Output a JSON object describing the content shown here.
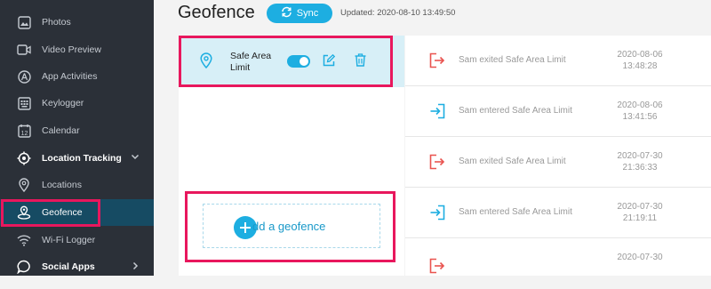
{
  "sidebar": {
    "items": [
      {
        "label": "Photos",
        "icon": "image-icon"
      },
      {
        "label": "Video Preview",
        "icon": "video-icon"
      },
      {
        "label": "App Activities",
        "icon": "app-store-icon"
      },
      {
        "label": "Keylogger",
        "icon": "keyboard-icon"
      },
      {
        "label": "Calendar",
        "icon": "calendar-icon"
      },
      {
        "label": "Location Tracking",
        "icon": "crosshair-icon"
      },
      {
        "label": "Locations",
        "icon": "map-pin-icon"
      },
      {
        "label": "Geofence",
        "icon": "geofence-icon"
      },
      {
        "label": "Wi-Fi Logger",
        "icon": "wifi-icon"
      },
      {
        "label": "Social Apps",
        "icon": "chat-bubble-icon"
      }
    ],
    "calendar_day": "12"
  },
  "header": {
    "title": "Geofence",
    "sync_label": "Sync",
    "updated": "Updated: 2020-08-10 13:49:50"
  },
  "geofences": [
    {
      "name": "Safe Area Limit",
      "enabled": true
    }
  ],
  "add_geofence_label": "dd a geofence",
  "events": [
    {
      "text": "Sam exited Safe Area Limit",
      "date": "2020-08-06",
      "time": "13:48:28",
      "type": "exit"
    },
    {
      "text": "Sam entered Safe Area Limit",
      "date": "2020-08-06",
      "time": "13:41:56",
      "type": "enter"
    },
    {
      "text": "Sam exited Safe Area Limit",
      "date": "2020-07-30",
      "time": "21:36:33",
      "type": "exit"
    },
    {
      "text": "Sam entered Safe Area Limit",
      "date": "2020-07-30",
      "time": "21:19:11",
      "type": "enter"
    },
    {
      "text": "",
      "date": "2020-07-30",
      "time": "",
      "type": "exit"
    }
  ],
  "colors": {
    "accent": "#1daee1",
    "highlight": "#e8175d",
    "exit": "#e9534f",
    "enter": "#1daee1"
  }
}
